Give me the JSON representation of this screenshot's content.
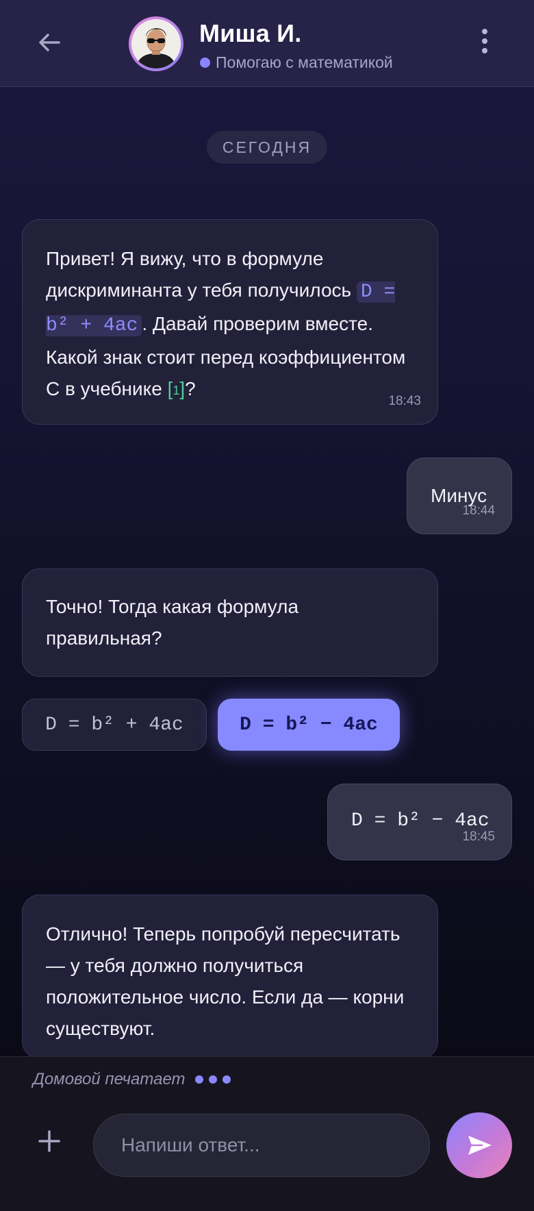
{
  "header": {
    "name": "Миша И.",
    "status": "Помогаю с математикой",
    "status_color": "#8a85ff"
  },
  "date_label": "СЕГОДНЯ",
  "messages": [
    {
      "from": "bot",
      "text_a": "Привет! Я вижу, что в формуле дискриминанта у тебя получилось ",
      "code": "D = b² + 4ac",
      "text_b": ". Давай проверим вместе. Какой знак стоит перед коэффициентом С в учебнике ",
      "cite": "1",
      "text_c": "?",
      "time": "18:43"
    },
    {
      "from": "user",
      "text": "Минус",
      "time": "18:44"
    },
    {
      "from": "bot",
      "text": "Точно! Тогда какая формула правильная?"
    },
    {
      "from": "user",
      "text": "D = b² − 4ac",
      "time": "18:45"
    },
    {
      "from": "bot",
      "text": "Отлично! Теперь попробуй пересчитать — у тебя должно получиться положительное число. Если да — корни существуют."
    }
  ],
  "options": [
    {
      "label": "D = b² + 4ac",
      "selected": false
    },
    {
      "label": "D = b² − 4ac",
      "selected": true
    }
  ],
  "typing_text": "Домовой печатает",
  "composer": {
    "placeholder": "Напиши ответ...",
    "value": ""
  },
  "icons": {
    "back": "arrow-left-icon",
    "menu": "more-vertical-icon",
    "plus": "plus-icon",
    "send": "send-icon"
  },
  "colors": {
    "accent": "#8789ff",
    "cite": "#4fcf95",
    "send_gradient": [
      "#8b84ff",
      "#e884b9"
    ]
  }
}
